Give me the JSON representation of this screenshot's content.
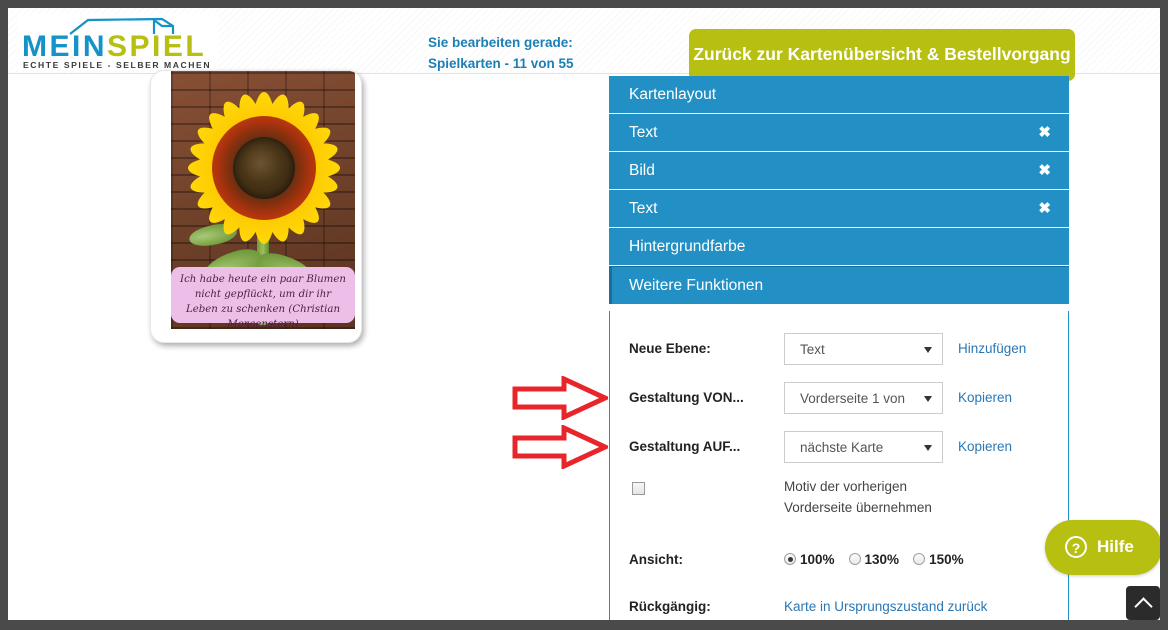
{
  "brand": {
    "name_part1": "MEIN",
    "name_part2": "SPIEL",
    "tagline": "ECHTE SPIELE - SELBER MACHEN",
    "color_blue": "#1592c8",
    "color_olive": "#b7bf10"
  },
  "header": {
    "status_line1": "Sie bearbeiten gerade:",
    "status_line2": "Spielkarten - 11 von 55",
    "back_button": "Zurück zur Kartenübersicht & Bestellvorgang",
    "status_color": "#1b7fb5"
  },
  "card": {
    "quote": "Ich habe heute ein paar Blumen nicht gepflückt, um dir ihr Leben zu schenken (Christian Morgenstern)",
    "quote_background": "#edbfe8",
    "image_subject": "sunflower-photo"
  },
  "accordion": {
    "items": [
      {
        "label": "Kartenlayout",
        "closable": false,
        "active": false
      },
      {
        "label": "Text",
        "closable": true,
        "active": false
      },
      {
        "label": "Bild",
        "closable": true,
        "active": false
      },
      {
        "label": "Text",
        "closable": true,
        "active": false
      },
      {
        "label": "Hintergrundfarbe",
        "closable": false,
        "active": false
      },
      {
        "label": "Weitere Funktionen",
        "closable": false,
        "active": true
      }
    ],
    "close_glyph": "✖",
    "header_color": "#2290c4"
  },
  "panel": {
    "rows": [
      {
        "label": "Neue Ebene:",
        "select_value": "Text",
        "action": "Hinzufügen"
      },
      {
        "label": "Gestaltung VON...",
        "select_value": "Vorderseite 1 von",
        "action": "Kopieren"
      },
      {
        "label": "Gestaltung AUF...",
        "select_value": "nächste Karte",
        "action": "Kopieren"
      }
    ],
    "checkbox": {
      "checked": false,
      "label_line1": "Motiv der vorherigen",
      "label_line2": "Vorderseite übernehmen"
    },
    "ansicht": {
      "label": "Ansicht:",
      "options": [
        {
          "label": "100%",
          "selected": true
        },
        {
          "label": "130%",
          "selected": false
        },
        {
          "label": "150%",
          "selected": false
        }
      ]
    },
    "undo": {
      "label": "Rückgängig:",
      "link": "Karte in Ursprungszustand zurück"
    },
    "link_color": "#2a77b5"
  },
  "annotations": {
    "arrow_color": "#e8252a",
    "arrow1_target": "Gestaltung VON...",
    "arrow2_target": "Gestaltung AUF..."
  },
  "widgets": {
    "help_label": "Hilfe",
    "help_icon": "?",
    "help_color": "#b7bf10",
    "scroll_top_icon": "chevron-up"
  }
}
